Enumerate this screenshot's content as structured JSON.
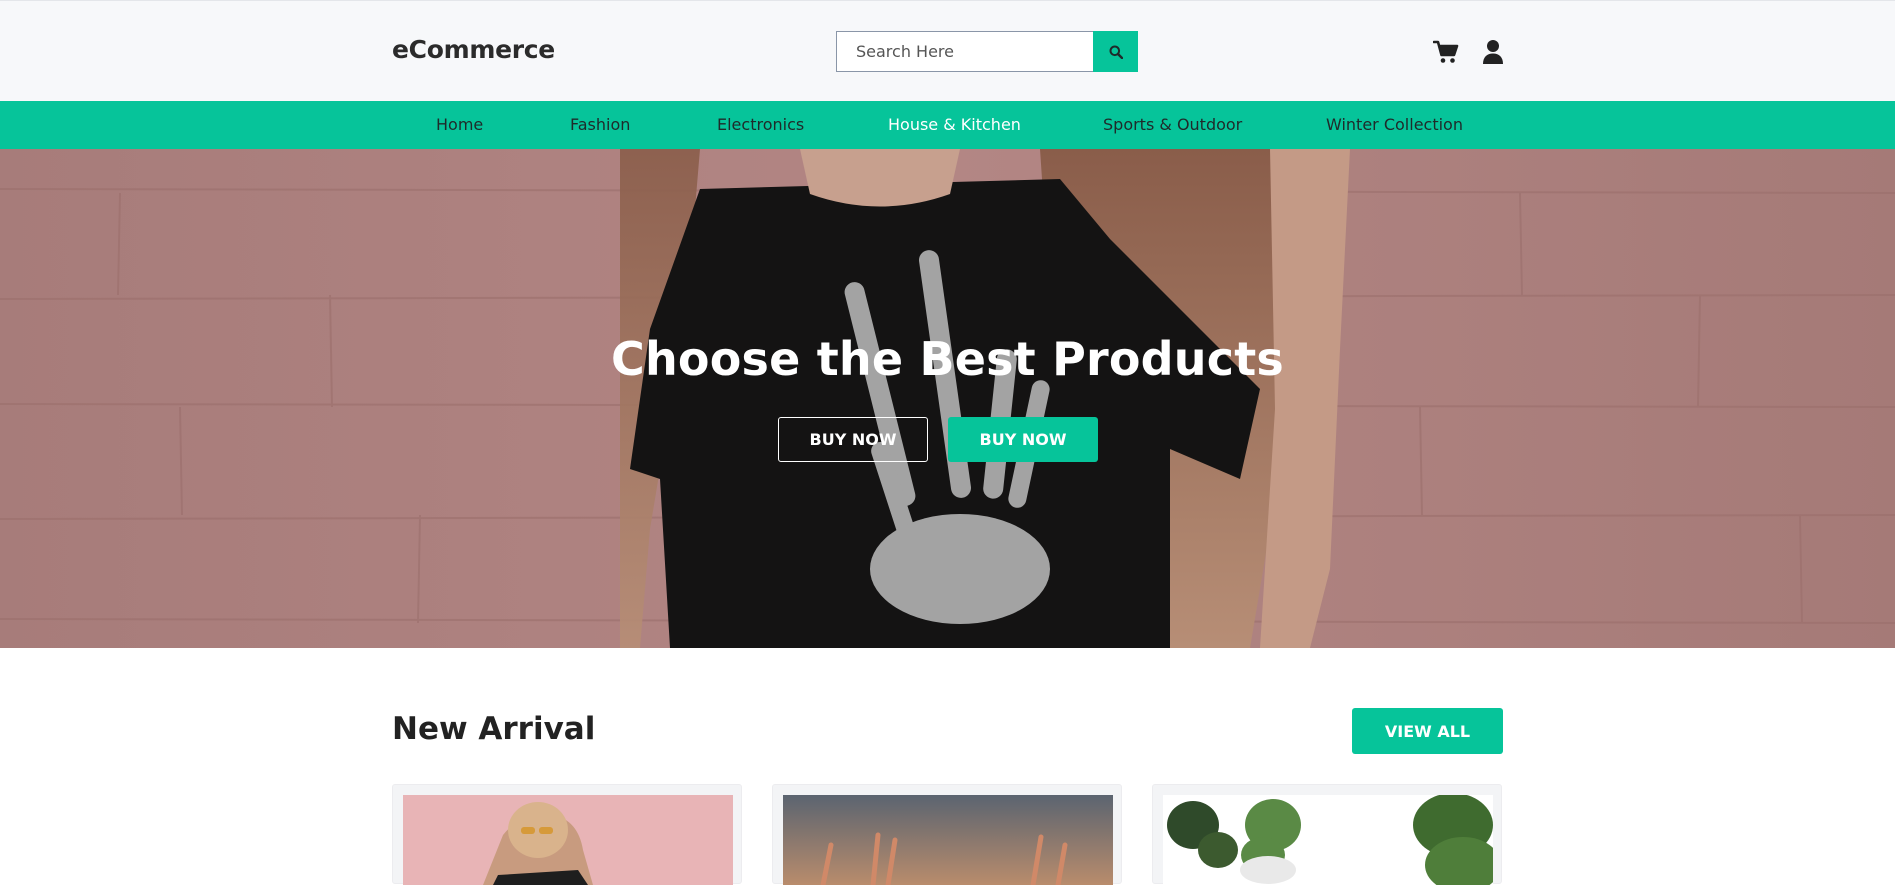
{
  "brand": {
    "name": "eCommerce",
    "accent": "#06c49a"
  },
  "search": {
    "placeholder": "Search Here",
    "button_icon": "search-icon"
  },
  "header_icons": [
    "cart-icon",
    "user-icon"
  ],
  "nav": {
    "items": [
      {
        "label": "Home",
        "active": false
      },
      {
        "label": "Fashion",
        "active": false
      },
      {
        "label": "Electronics",
        "active": false
      },
      {
        "label": "House & Kitchen",
        "active": true
      },
      {
        "label": "Sports & Outdoor",
        "active": false
      },
      {
        "label": "Winter Collection",
        "active": false
      }
    ]
  },
  "hero": {
    "title": "Choose the Best Products",
    "primary_button": "BUY NOW",
    "secondary_button": "BUY NOW"
  },
  "new_arrival": {
    "title": "New Arrival",
    "view_all": "VIEW ALL"
  }
}
